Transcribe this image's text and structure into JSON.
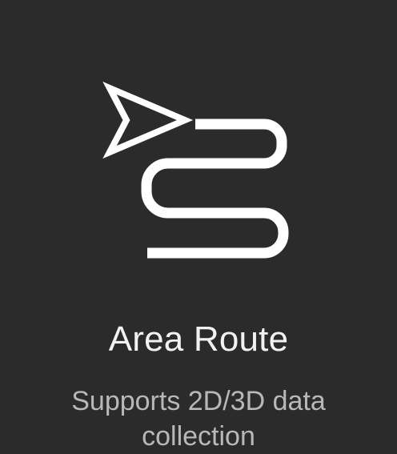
{
  "card": {
    "icon": "area-route-icon",
    "title": "Area Route",
    "description": "Supports 2D/3D data collection"
  },
  "colors": {
    "background": "#2b2b2b",
    "title": "#f2f2f2",
    "description": "#b8b8b8",
    "icon": "#ffffff"
  }
}
